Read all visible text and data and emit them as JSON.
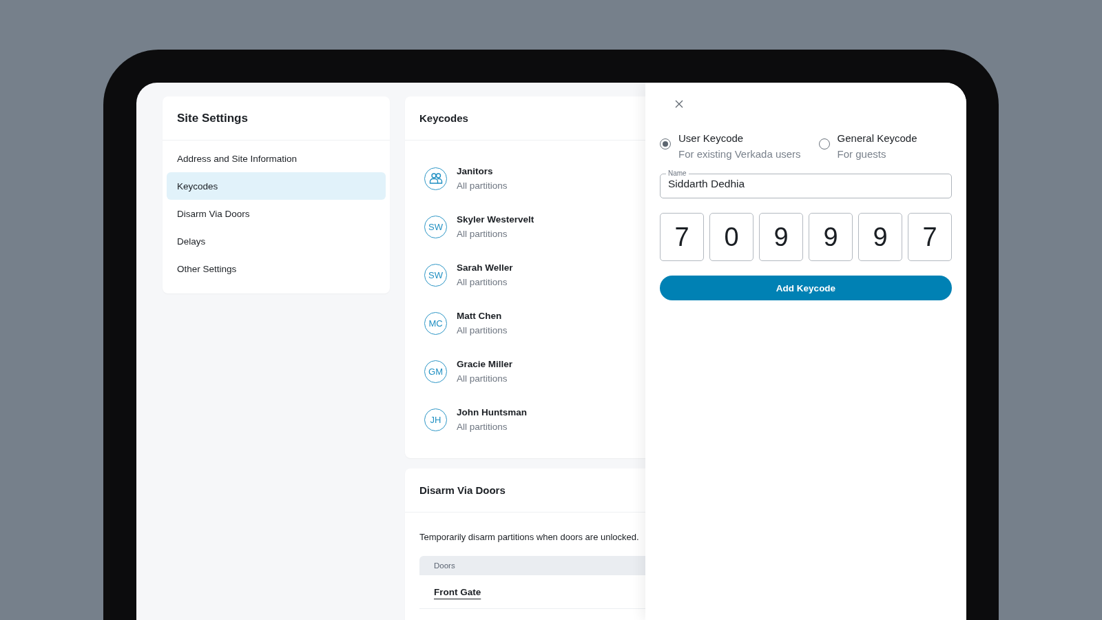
{
  "sidebar": {
    "title": "Site Settings",
    "items": [
      {
        "label": "Address and Site Information",
        "selected": false
      },
      {
        "label": "Keycodes",
        "selected": true
      },
      {
        "label": "Disarm Via Doors",
        "selected": false
      },
      {
        "label": "Delays",
        "selected": false
      },
      {
        "label": "Other Settings",
        "selected": false
      }
    ]
  },
  "keycodes": {
    "title": "Keycodes",
    "users": [
      {
        "kind": "group",
        "name": "Janitors",
        "subtitle": "All partitions"
      },
      {
        "kind": "person",
        "initials": "SW",
        "name": "Skyler Westervelt",
        "subtitle": "All partitions"
      },
      {
        "kind": "person",
        "initials": "SW",
        "name": "Sarah Weller",
        "subtitle": "All partitions"
      },
      {
        "kind": "person",
        "initials": "MC",
        "name": "Matt Chen",
        "subtitle": "All partitions"
      },
      {
        "kind": "person",
        "initials": "GM",
        "name": "Gracie Miller",
        "subtitle": "All partitions"
      },
      {
        "kind": "person",
        "initials": "JH",
        "name": "John Huntsman",
        "subtitle": "All partitions"
      }
    ]
  },
  "disarm": {
    "title": "Disarm Via Doors",
    "description": "Temporarily disarm partitions when doors are unlocked.",
    "table": {
      "columns": [
        "Doors"
      ],
      "rows": [
        {
          "door": "Front Gate"
        }
      ]
    }
  },
  "panel": {
    "options": [
      {
        "label": "User Keycode",
        "description": "For existing Verkada users",
        "selected": true
      },
      {
        "label": "General Keycode",
        "description": "For guests",
        "selected": false
      }
    ],
    "name_field": {
      "label": "Name",
      "value": "Siddarth Dedhia"
    },
    "code_digits": [
      "7",
      "0",
      "9",
      "9",
      "9",
      "7"
    ],
    "button": "Add Keycode"
  }
}
